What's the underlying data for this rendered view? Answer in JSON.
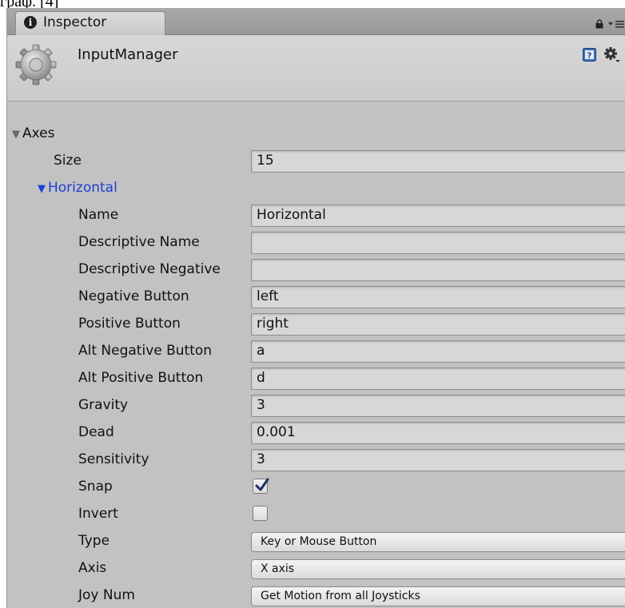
{
  "caption": "граф. [4]",
  "tab": {
    "label": "Inspector",
    "icon": "info-icon"
  },
  "header": {
    "title": "InputManager",
    "icon": "gear-icon"
  },
  "axes": {
    "label": "Axes",
    "expanded": true
  },
  "size": {
    "label": "Size",
    "value": "15"
  },
  "horizontal": {
    "label": "Horizontal",
    "expanded": true,
    "color": "#1f3fd6"
  },
  "fields": {
    "name": {
      "label": "Name",
      "value": "Horizontal"
    },
    "descriptive_name": {
      "label": "Descriptive Name",
      "value": ""
    },
    "descriptive_negative": {
      "label": "Descriptive Negative",
      "value": ""
    },
    "negative_button": {
      "label": "Negative Button",
      "value": "left"
    },
    "positive_button": {
      "label": "Positive Button",
      "value": "right"
    },
    "alt_negative_button": {
      "label": "Alt Negative Button",
      "value": "a"
    },
    "alt_positive_button": {
      "label": "Alt Positive Button",
      "value": "d"
    },
    "gravity": {
      "label": "Gravity",
      "value": "3"
    },
    "dead": {
      "label": "Dead",
      "value": "0.001"
    },
    "sensitivity": {
      "label": "Sensitivity",
      "value": "3"
    }
  },
  "snap": {
    "label": "Snap",
    "checked": true
  },
  "invert": {
    "label": "Invert",
    "checked": false
  },
  "type": {
    "label": "Type",
    "value": "Key or Mouse Button"
  },
  "axis": {
    "label": "Axis",
    "value": "X axis"
  },
  "joy_num": {
    "label": "Joy Num",
    "value": "Get Motion from all Joysticks"
  }
}
